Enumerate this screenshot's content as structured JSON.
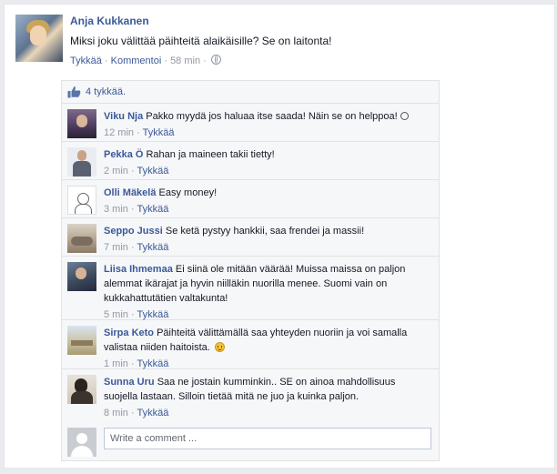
{
  "post": {
    "author": "Anja Kukkanen",
    "text": "Miksi joku välittää päihteitä alaikäisille? Se on laitonta!",
    "like_label": "Tykkää",
    "comment_label": "Kommentoi",
    "time": "58 min",
    "separator": " · ",
    "privacy_icon": "globe-icon"
  },
  "likes": {
    "text": "4 tykkää.",
    "icon": "thumbs-up-icon"
  },
  "comments": [
    {
      "author": "Viku Nja",
      "text": "Pakko myydä jos haluaa itse saada! Näin se on helppoa!",
      "time": "12 min",
      "like_label": "Tykkää",
      "emoticon": "small-smiley-icon"
    },
    {
      "author": "Pekka Ö",
      "text": "Rahan ja maineen takii tietty!",
      "time": "2 min",
      "like_label": "Tykkää"
    },
    {
      "author": "Olli Mäkelä",
      "text": "Easy money!",
      "time": "3 min",
      "like_label": "Tykkää"
    },
    {
      "author": "Seppo Jussi",
      "text": "Se ketä pystyy hankkii, saa frendei ja massii!",
      "time": "7 min",
      "like_label": "Tykkää"
    },
    {
      "author": "Liisa Ihmemaa",
      "text": "Ei siinä ole mitään väärää! Muissa maissa on paljon alemmat ikärajat ja hyvin niilläkin nuorilla menee. Suomi vain on kukkahattutätien valtakunta!",
      "time": "5 min",
      "like_label": "Tykkää"
    },
    {
      "author": "Sirpa Keto",
      "text": "Päihteitä välittämällä saa yhteyden nuoriin ja voi samalla valistaa niiden haitoista.",
      "time": "1 min",
      "like_label": "Tykkää",
      "emoticon": "smiley-icon"
    },
    {
      "author": "Sunna Uru",
      "text": "Saa ne jostain kumminkin.. SE on ainoa mahdollisuus suojella lastaan. Silloin tietää mitä ne juo ja kuinka paljon.",
      "time": "8 min",
      "like_label": "Tykkää"
    }
  ],
  "compose": {
    "placeholder": "Write a comment ..."
  },
  "colors": {
    "link": "#3b5998",
    "meta": "#9197a3",
    "ufi_bg": "#f6f7f9",
    "page_bg": "#e9ebee"
  }
}
